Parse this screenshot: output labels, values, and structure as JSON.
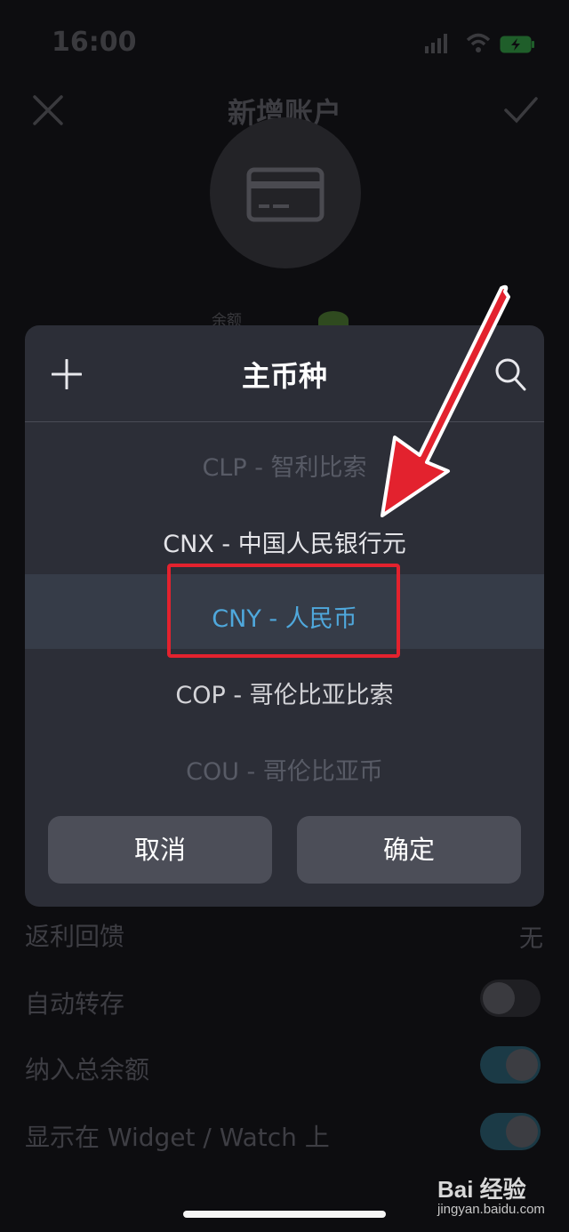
{
  "status_bar": {
    "time": "16:00"
  },
  "nav": {
    "title": "新增账户"
  },
  "form": {
    "balance_label": "余额"
  },
  "modal": {
    "title": "主币种",
    "options": [
      "CLP - 智利比索",
      "CNX - 中国人民银行元",
      "CNY - 人民币",
      "COP - 哥伦比亚比索",
      "COU - 哥伦比亚币"
    ],
    "selected_index": 2,
    "cancel_label": "取消",
    "confirm_label": "确定"
  },
  "settings": {
    "rebate_label": "返利回馈",
    "rebate_value": "无",
    "auto_transfer_label": "自动转存",
    "auto_transfer_on": false,
    "include_total_label": "纳入总余额",
    "include_total_on": true,
    "widget_label": "显示在 Widget / Watch 上",
    "widget_on": true
  },
  "watermark": {
    "brand": "Bai 经验",
    "url": "jingyan.baidu.com"
  },
  "colors": {
    "accent": "#4fa8dc",
    "highlight_border": "#e3222e",
    "arrow": "#e3222e"
  }
}
